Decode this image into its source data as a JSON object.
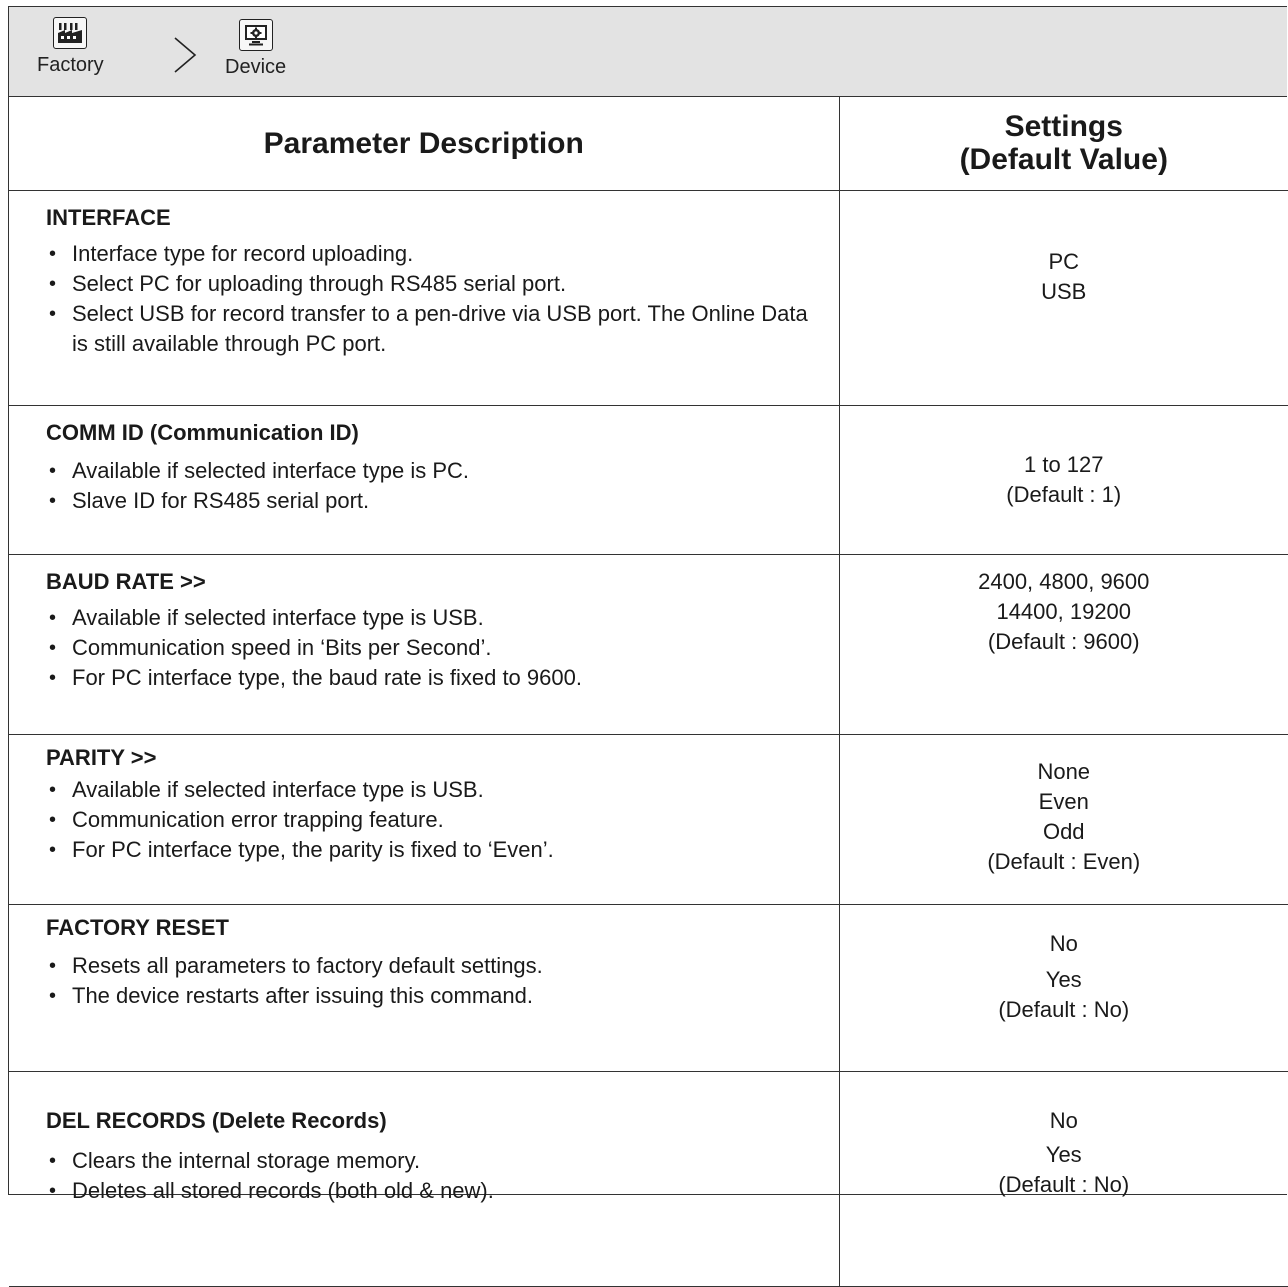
{
  "breadcrumb": {
    "items": [
      {
        "label": "Factory",
        "icon": "factory-icon"
      },
      {
        "label": "Device",
        "icon": "device-settings-icon"
      }
    ],
    "separator_icon": "chevron-right-icon"
  },
  "table": {
    "headers": {
      "description": "Parameter Description",
      "settings_line1": "Settings",
      "settings_line2": "(Default Value)"
    },
    "rows": [
      {
        "title": "INTERFACE",
        "bullets": [
          "Interface type for record uploading.",
          "Select PC for uploading through RS485 serial port.",
          "Select USB for record transfer to a pen-drive via USB port.  The Online Data is still available through PC port."
        ],
        "settings": [
          "PC",
          "USB"
        ]
      },
      {
        "title": "COMM ID (Communication ID)",
        "bullets": [
          "Available if selected interface type is PC.",
          "Slave ID for RS485 serial port."
        ],
        "settings": [
          "1 to 127",
          "(Default : 1)"
        ]
      },
      {
        "title": "BAUD RATE >>",
        "bullets": [
          "Available if selected interface type is USB.",
          "Communication speed in ‘Bits per Second’.",
          "For PC interface type, the baud rate is fixed to 9600."
        ],
        "settings": [
          "2400, 4800, 9600",
          "14400, 19200",
          "(Default : 9600)"
        ]
      },
      {
        "title": "PARITY >>",
        "bullets": [
          "Available if selected interface type is USB.",
          "Communication error trapping feature.",
          "For PC interface type, the parity is fixed to ‘Even’."
        ],
        "settings": [
          "None",
          "Even",
          "Odd",
          "(Default : Even)"
        ]
      },
      {
        "title": "FACTORY RESET",
        "bullets": [
          "Resets all parameters to factory default settings.",
          "The device restarts after issuing this command."
        ],
        "settings": [
          "No",
          "Yes",
          "(Default : No)"
        ]
      },
      {
        "title": "DEL RECORDS (Delete Records)",
        "bullets": [
          "Clears the internal storage memory.",
          "Deletes all stored records (both old & new)."
        ],
        "settings": [
          "No",
          "Yes",
          "(Default : No)"
        ]
      }
    ]
  }
}
